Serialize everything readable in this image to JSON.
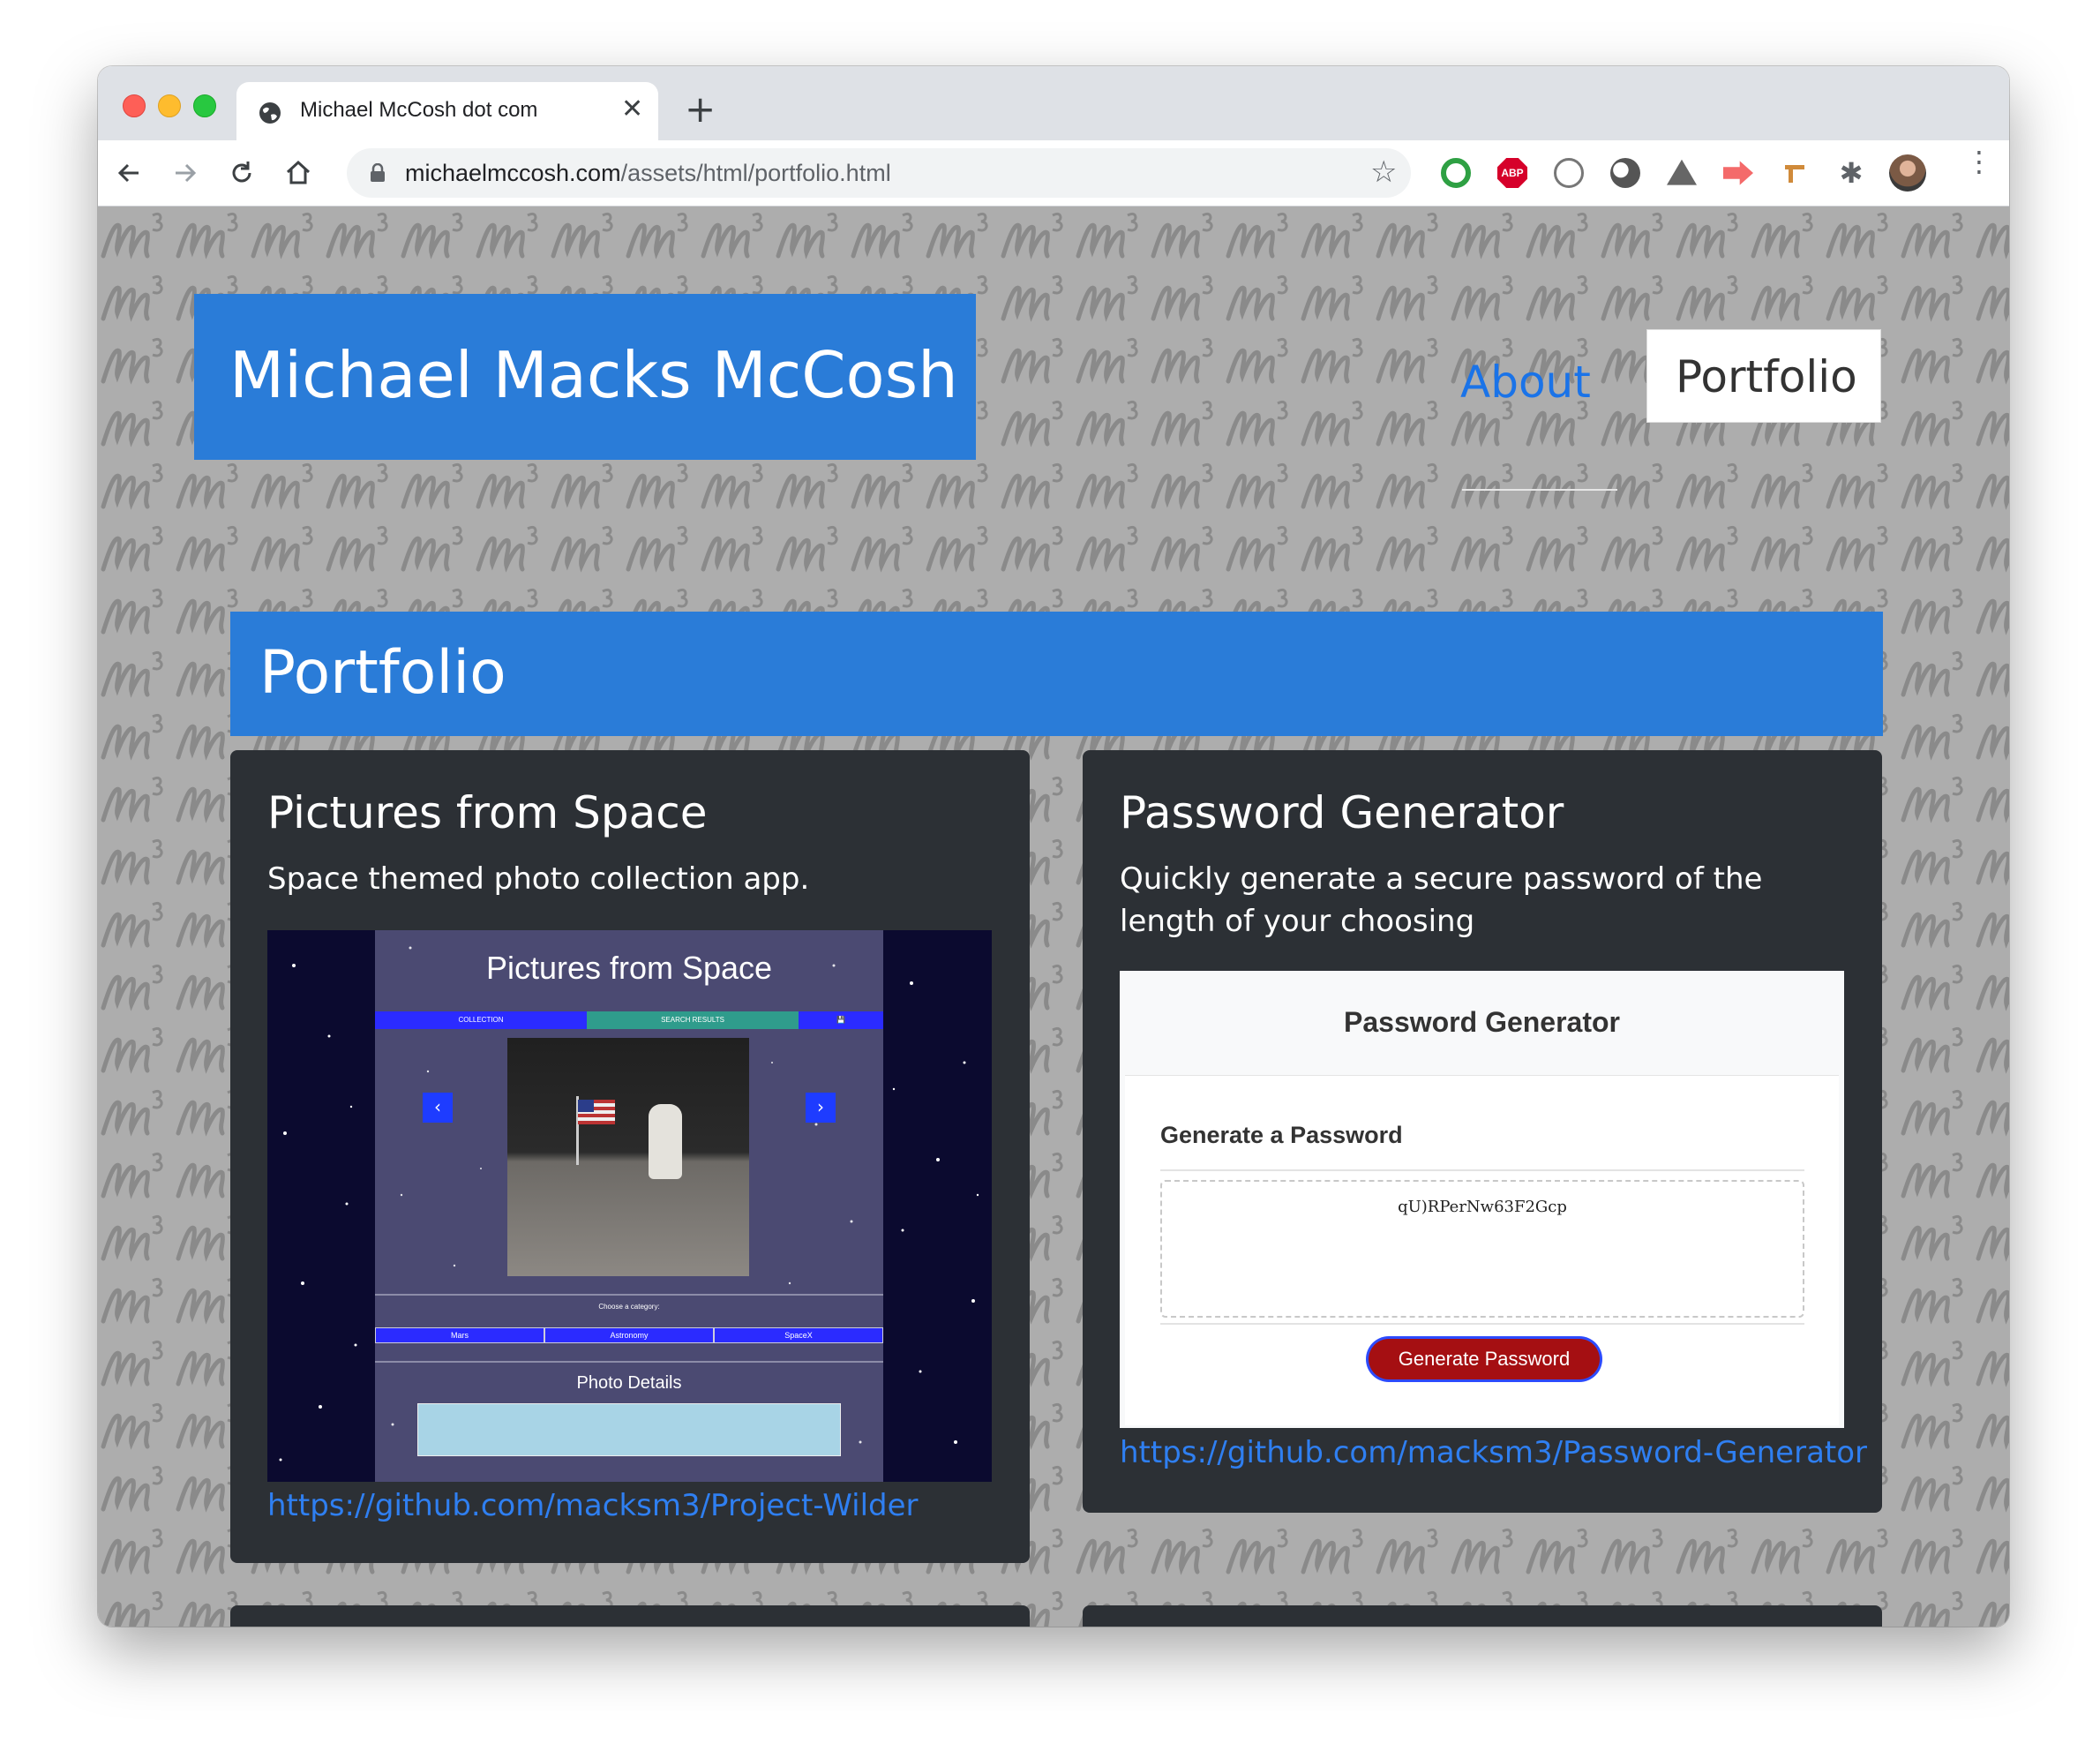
{
  "browser": {
    "tab_title": "Michael McCosh dot com",
    "tab_close": "✕",
    "new_tab": "+",
    "url_domain": "michaelmccosh.com",
    "url_path": "/assets/html/portfolio.html",
    "bookmark_icon": "☆",
    "extensions_icon": "✱",
    "menu_icon": "⋮",
    "icons": [
      "globe-icon",
      "back-icon",
      "forward-icon",
      "reload-icon",
      "home-icon",
      "lock-icon",
      "star-icon",
      "extension-icons",
      "puzzle-icon",
      "profile-avatar",
      "kebab-menu-icon"
    ]
  },
  "site": {
    "title": "Michael Macks McCosh",
    "nav": {
      "about": "About",
      "portfolio": "Portfolio"
    },
    "accent": "#2a7cd8",
    "link_color": "#2f7ff1"
  },
  "banner": {
    "title": "Portfolio"
  },
  "projects": [
    {
      "title": "Pictures from Space",
      "description": "Space themed photo collection app.",
      "link": "https://github.com/macksm3/Project-Wilder",
      "screenshot": {
        "title": "Pictures from Space",
        "tabs": [
          "COLLECTION",
          "SEARCH RESULTS",
          "💾"
        ],
        "prev": "‹",
        "next": "›",
        "category_label": "Choose a category:",
        "categories": [
          "Mars",
          "Astronomy",
          "SpaceX"
        ],
        "details_label": "Photo Details"
      }
    },
    {
      "title": "Password Generator",
      "description": "Quickly generate a secure password of the length of your choosing",
      "link": "https://github.com/macksm3/Password-Generator",
      "screenshot": {
        "title": "Password Generator",
        "subtitle": "Generate a Password",
        "password": "qU)RPerNw63F2Gcp",
        "button": "Generate Password"
      }
    }
  ]
}
